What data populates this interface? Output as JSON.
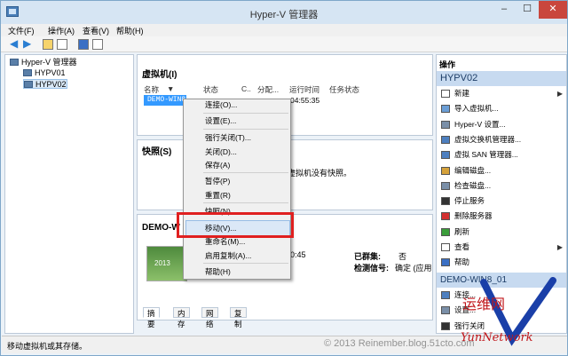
{
  "window": {
    "title": "Hyper-V 管理器"
  },
  "menu": [
    "文件(F)",
    "操作(A)",
    "查看(V)",
    "帮助(H)"
  ],
  "tree": {
    "root": "Hyper-V 管理器",
    "nodes": [
      "HYPV01",
      "HYPV02"
    ]
  },
  "vm_section": {
    "title": "虚拟机(I)",
    "columns": [
      "名称",
      "状态",
      "C..",
      "分配...",
      "运行时间",
      "任务状态"
    ],
    "row": {
      "name": "DEMO-WIN8",
      "uptime": "04:55:35"
    }
  },
  "snapshot_section": {
    "title": "快照(S)",
    "message": "的虚拟机没有快照。"
  },
  "details": {
    "title": "DEMO-W",
    "time": "30:45",
    "cluster_label": "已群集:",
    "cluster_value": "否",
    "heartbeat_label": "检测信号:",
    "heartbeat_value": "确定 (应用",
    "tabs": [
      "摘要",
      "内存",
      "网络",
      "复制"
    ]
  },
  "context_menu": [
    "连接(O)...",
    "设置(E)...",
    "强行关闭(T)...",
    "关闭(D)...",
    "保存(A)",
    "暂停(P)",
    "重置(R)",
    "快照(N)",
    "移动(V)...",
    "重命名(M)...",
    "启用复制(A)...",
    "帮助(H)"
  ],
  "actions": {
    "header": "操作",
    "group1": "HYPV02",
    "items1": [
      {
        "label": "新建",
        "icon": "new-icon",
        "arrow": true
      },
      {
        "label": "导入虚拟机...",
        "icon": "import-icon"
      },
      {
        "label": "Hyper-V 设置...",
        "icon": "settings-icon"
      },
      {
        "label": "虚拟交换机管理器...",
        "icon": "switch-icon"
      },
      {
        "label": "虚拟 SAN 管理器...",
        "icon": "san-icon"
      },
      {
        "label": "编辑磁盘...",
        "icon": "edit-disk-icon"
      },
      {
        "label": "检查磁盘...",
        "icon": "inspect-disk-icon"
      },
      {
        "label": "停止服务",
        "icon": "stop-icon"
      },
      {
        "label": "删除服务器",
        "icon": "delete-icon"
      },
      {
        "label": "刷新",
        "icon": "refresh-icon"
      },
      {
        "label": "查看",
        "icon": "view-icon",
        "arrow": true
      },
      {
        "label": "帮助",
        "icon": "help-icon"
      }
    ],
    "group2": "DEMO-WIN8_01",
    "items2": [
      {
        "label": "连接...",
        "icon": "connect-icon"
      },
      {
        "label": "设置...",
        "icon": "vm-settings-icon"
      },
      {
        "label": "强行关闭",
        "icon": "turnoff-icon"
      }
    ]
  },
  "status": "移动虚拟机或其存储。",
  "watermark": "© 2013 Reinember.blog.51cto.com",
  "logo": {
    "cn": "运维网",
    "en": "YunNetwork"
  },
  "colors": {
    "accent": "#3399ff",
    "highlight_box": "#e02020",
    "action_header": "#c7daf0"
  }
}
